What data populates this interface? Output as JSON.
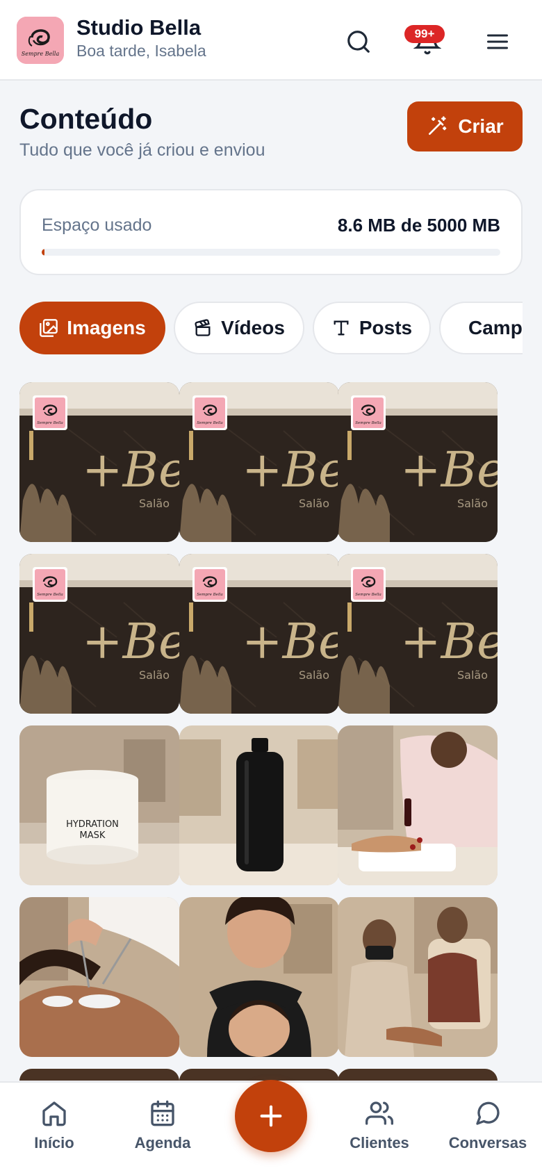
{
  "header": {
    "brand_name": "Studio Bella",
    "greeting": "Boa tarde, Isabela",
    "logo_text": "Sempre Bella",
    "notification_badge": "99+",
    "icons": [
      "search-icon",
      "bell-icon",
      "menu-icon"
    ]
  },
  "page": {
    "title": "Conteúdo",
    "subtitle": "Tudo que você já criou e enviou",
    "create_label": "Criar"
  },
  "storage": {
    "label": "Espaço usado",
    "value": "8.6 MB de 5000 MB",
    "fraction_used": 0.0017
  },
  "tabs": [
    {
      "label": "Imagens",
      "icon": "image-icon",
      "active": true
    },
    {
      "label": "Vídeos",
      "icon": "clapperboard-icon",
      "active": false
    },
    {
      "label": "Posts",
      "icon": "text-icon",
      "active": false
    },
    {
      "label": "Campanhas",
      "icon": "megaphone-icon",
      "active": false
    }
  ],
  "images": [
    {
      "kind": "salon-sign",
      "sign_text": "+Bella",
      "sub_text": "Salão",
      "watermark": "Sempre Bella"
    },
    {
      "kind": "salon-sign",
      "sign_text": "+Bella",
      "sub_text": "Salão",
      "watermark": "Sempre Bella"
    },
    {
      "kind": "salon-sign",
      "sign_text": "+Bella",
      "sub_text": "Salão",
      "watermark": "Sempre Bella"
    },
    {
      "kind": "salon-sign",
      "sign_text": "+Bella",
      "sub_text": "Salão",
      "watermark": "Sempre Bella"
    },
    {
      "kind": "salon-sign",
      "sign_text": "+Bella",
      "sub_text": "Salão",
      "watermark": "Sempre Bella"
    },
    {
      "kind": "salon-sign",
      "sign_text": "+Bella",
      "sub_text": "Salão",
      "watermark": "Sempre Bella"
    },
    {
      "kind": "jar",
      "jar_text_1": "HYDRATION",
      "jar_text_2": "MASK"
    },
    {
      "kind": "bottle"
    },
    {
      "kind": "manicure"
    },
    {
      "kind": "lashes"
    },
    {
      "kind": "brows"
    },
    {
      "kind": "pedicure"
    },
    {
      "kind": "partial"
    },
    {
      "kind": "partial"
    },
    {
      "kind": "partial"
    }
  ],
  "bottom_nav": [
    {
      "label": "Início",
      "icon": "home-icon"
    },
    {
      "label": "Agenda",
      "icon": "calendar-icon"
    },
    {
      "label": "",
      "icon": "plus-icon"
    },
    {
      "label": "Clientes",
      "icon": "users-icon"
    },
    {
      "label": "Conversas",
      "icon": "chat-icon"
    }
  ],
  "colors": {
    "accent": "#c2410c",
    "badge": "#dc2626",
    "logo_bg": "#f4a7b4"
  }
}
